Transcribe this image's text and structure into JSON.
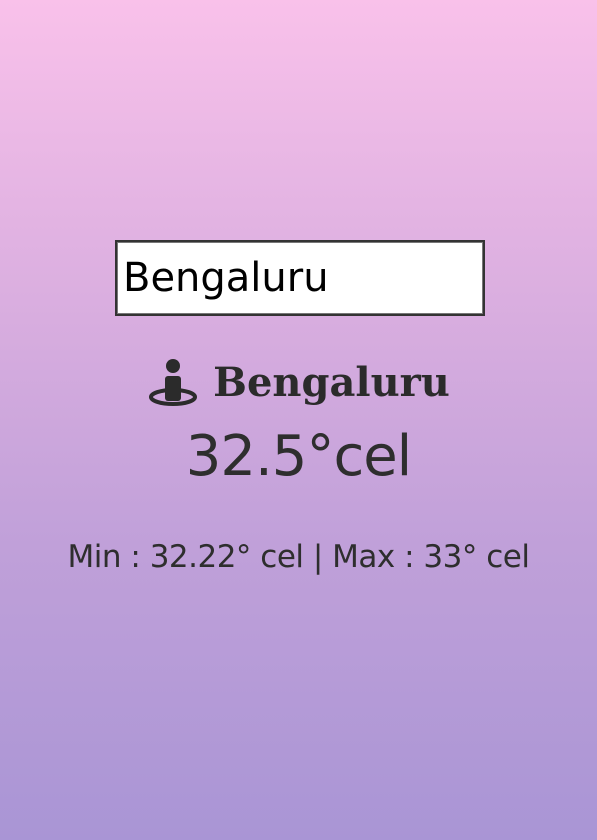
{
  "search": {
    "value": "Bengaluru"
  },
  "weather": {
    "city": "Bengaluru",
    "city_icon": "person-location-icon",
    "temperature": "32.5°cel",
    "minmax": "Min : 32.22° cel | Max : 33° cel"
  },
  "colors": {
    "gradient_top": "#f9c1ea",
    "gradient_bottom": "#a995d5",
    "text": "#2e2e2e"
  }
}
